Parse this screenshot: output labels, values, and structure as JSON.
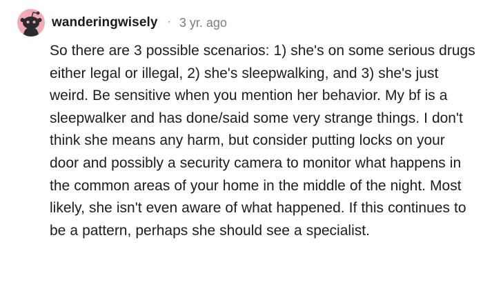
{
  "comment": {
    "author": "wanderingwisely",
    "separator": "·",
    "timestamp": "3 yr. ago",
    "avatar_icon": "snoo-avatar-icon",
    "avatar_color": "#f3a9b6",
    "body": "So there are 3 possible scenarios: 1) she's on some serious drugs either legal or illegal, 2) she's sleepwalking, and 3) she's just weird. Be sensitive when you mention her behavior. My bf is a sleepwalker and has done/said some very strange things. I don't think she means any harm, but consider putting locks on your door and possibly a security camera to monitor what happens in the common areas of your home in the middle of the night. Most likely, she isn't even aware of what happened. If this continues to be a pattern, perhaps she should see a specialist."
  }
}
